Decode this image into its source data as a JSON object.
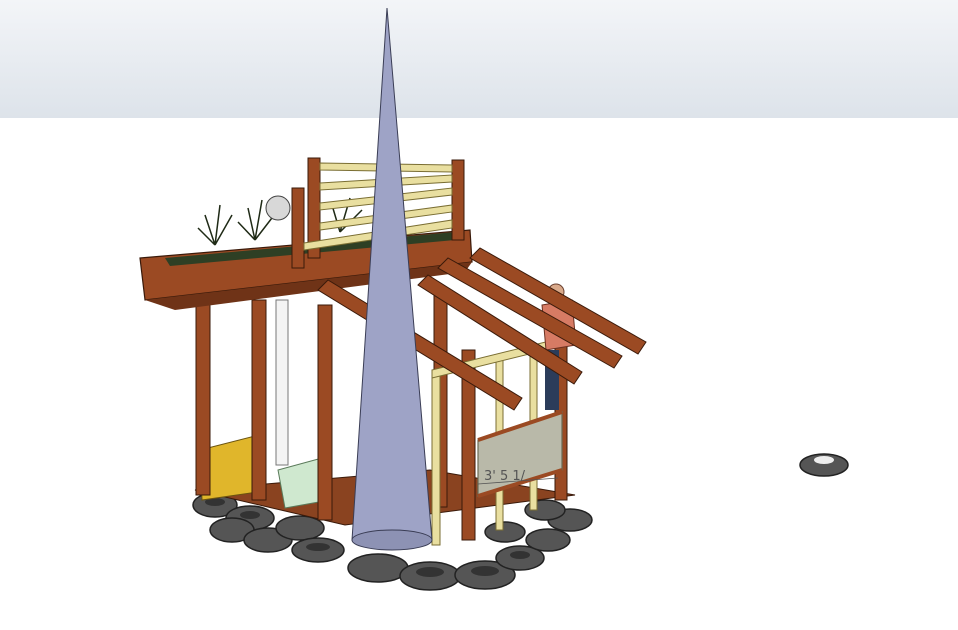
{
  "viewport": {
    "sky_color": "#e6eaef",
    "ground_color": "#ffffff"
  },
  "model": {
    "dimension_label": "3' 5 1/",
    "colors": {
      "wood": "#9b4a23",
      "wood_dark": "#6f3317",
      "pine": "#e9dfa0",
      "tire": "#5a5a5a",
      "tire_dark": "#333333",
      "spire": "#9ea3c6",
      "glass": "#b9b9a9",
      "foliage": "#2e3f24",
      "yellow_panel": "#e0b62b",
      "tub": "#cfe8cf"
    }
  }
}
